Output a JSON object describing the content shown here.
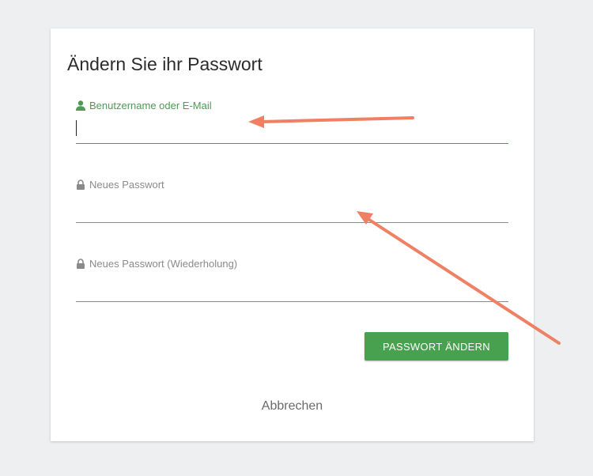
{
  "dialog": {
    "title": "Ändern Sie ihr Passwort",
    "fields": [
      {
        "label": "Benutzername oder E-Mail",
        "icon": "user-icon",
        "value": "",
        "placeholder": ""
      },
      {
        "label": "Neues Passwort",
        "icon": "lock-icon",
        "value": "",
        "placeholder": ""
      },
      {
        "label": "Neues Passwort (Wiederholung)",
        "icon": "lock-icon",
        "value": "",
        "placeholder": ""
      }
    ],
    "submit_label": "PASSWORT ÄNDERN",
    "cancel_label": "Abbrechen"
  },
  "colors": {
    "accent": "#47a14e",
    "active_label": "#4f9a56",
    "annotation_arrow": "#ef8063"
  }
}
